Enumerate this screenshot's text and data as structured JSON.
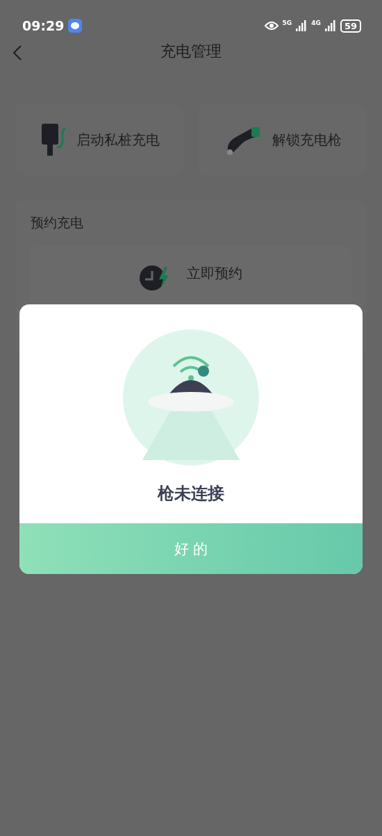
{
  "status_bar": {
    "time": "09:29",
    "network_1": "5G",
    "network_2": "4G",
    "battery": "59"
  },
  "header": {
    "title": "充电管理"
  },
  "actions": [
    {
      "kind": "charger",
      "label": "启动私桩充电"
    },
    {
      "kind": "plug",
      "label": "解锁充电枪"
    }
  ],
  "schedule": {
    "title": "预约充电",
    "button": "立即预约"
  },
  "dialog": {
    "message": "枪未连接",
    "button": "好 的"
  }
}
